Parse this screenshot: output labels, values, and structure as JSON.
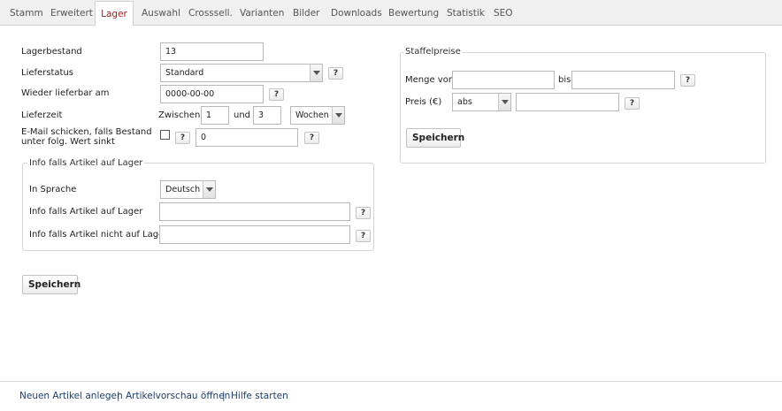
{
  "tabs": [
    {
      "label": "Stamm"
    },
    {
      "label": "Erweitert"
    },
    {
      "label": "Lager"
    },
    {
      "label": "Auswahl"
    },
    {
      "label": "Crosssell."
    },
    {
      "label": "Varianten"
    },
    {
      "label": "Bilder"
    },
    {
      "label": "Downloads"
    },
    {
      "label": "Bewertung"
    },
    {
      "label": "Statistik"
    },
    {
      "label": "SEO"
    }
  ],
  "active_tab": "Lager",
  "help_label": "?",
  "form": {
    "lagerbestand_label": "Lagerbestand",
    "lagerbestand_value": "13",
    "lieferstatus_label": "Lieferstatus",
    "lieferstatus_value": "Standard",
    "wieder_label": "Wieder lieferbar am",
    "wieder_value": "0000-00-00",
    "lieferzeit_label": "Lieferzeit",
    "zwischen_label": "Zwischen",
    "lieferzeit_from": "1",
    "und_label": "und",
    "lieferzeit_to": "3",
    "lieferzeit_unit": "Wochen",
    "email_label_line1": "E-Mail schicken, falls Bestand",
    "email_label_line2": "unter folg. Wert sinkt",
    "email_checked": false,
    "email_threshold": "0"
  },
  "info_group": {
    "legend": "Info falls Artikel auf Lager",
    "sprache_label": "In Sprache",
    "sprache_value": "Deutsch",
    "auf_lager_label": "Info falls Artikel auf Lager",
    "auf_lager_value": "",
    "nicht_auf_lager_label": "Info falls Artikel nicht auf Lager",
    "nicht_auf_lager_value": ""
  },
  "save_label": "Speichern",
  "staffel": {
    "legend": "Staffelpreise",
    "menge_von_label": "Menge von",
    "menge_von_value": "",
    "bis_label": "bis",
    "bis_value": "",
    "preis_label": "Preis (€)",
    "preis_type": "abs",
    "preis_value": "",
    "save_label": "Speichern"
  },
  "footer": {
    "links": [
      "Neuen Artikel anlegen",
      "Artikelvorschau öffnen",
      "Hilfe starten"
    ],
    "separator": "|"
  }
}
